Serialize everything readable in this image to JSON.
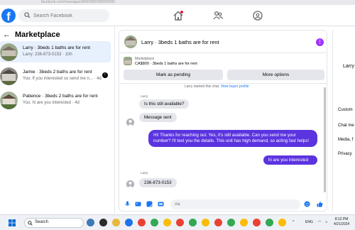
{
  "browser": {
    "url": "facebook.com/messages/t/0000000000000000"
  },
  "nav": {
    "search_placeholder": "Search Facebook",
    "icons": [
      "home-icon",
      "friends-icon",
      "groups-icon"
    ]
  },
  "sidebar": {
    "title": "Marketplace",
    "chats": [
      {
        "title": "Larry · 3beds 1 baths are for rent",
        "subtitle": "Larry: 236-873-0153 · 10h",
        "active": true
      },
      {
        "title": "Jamie · 3beds 2 baths are for rent",
        "subtitle": "You: If you interested so send me n... · 4d",
        "unread": true
      },
      {
        "title": "Patience · 3beds 2 baths are for rent",
        "subtitle": "You: hi are you interested · 4d"
      }
    ]
  },
  "chat": {
    "title": "Larry · 3beds 1 baths are for rent",
    "listing": {
      "label": "Marketplace",
      "description": "CA$800 · 3beds 1 baths are for rent"
    },
    "buttons": {
      "pending": "Mark as pending",
      "more": "More options"
    },
    "system_note": "Larry started this chat.",
    "system_link": "View buyer profile",
    "messages": [
      {
        "sender": "Larry",
        "text": "Is this still available?"
      },
      {
        "text": "Message sent"
      },
      {
        "outgoing": true,
        "text": "Hi! Thanks for reaching out. Yes, it's still available. Can you send me your number? I'll text you the details. This unit has high demand, so acting fast helps!"
      },
      {
        "outgoing": true,
        "text": "hi are you interested"
      },
      {
        "sender": "Larry",
        "text": "236-873-0153"
      }
    ],
    "composer_placeholder": "Aa"
  },
  "right_panel": {
    "name": "Larry",
    "items": [
      "Custom",
      "Chat me",
      "Media, f",
      "Privacy"
    ]
  },
  "taskbar": {
    "search_label": "Search",
    "lang": "ENG",
    "time": "8:12 PM",
    "date": "4/21/2024"
  },
  "colors": {
    "brand": "#1877f2",
    "outgoing_bubble": "#5b34e0",
    "options_dot": "#a033ff"
  }
}
